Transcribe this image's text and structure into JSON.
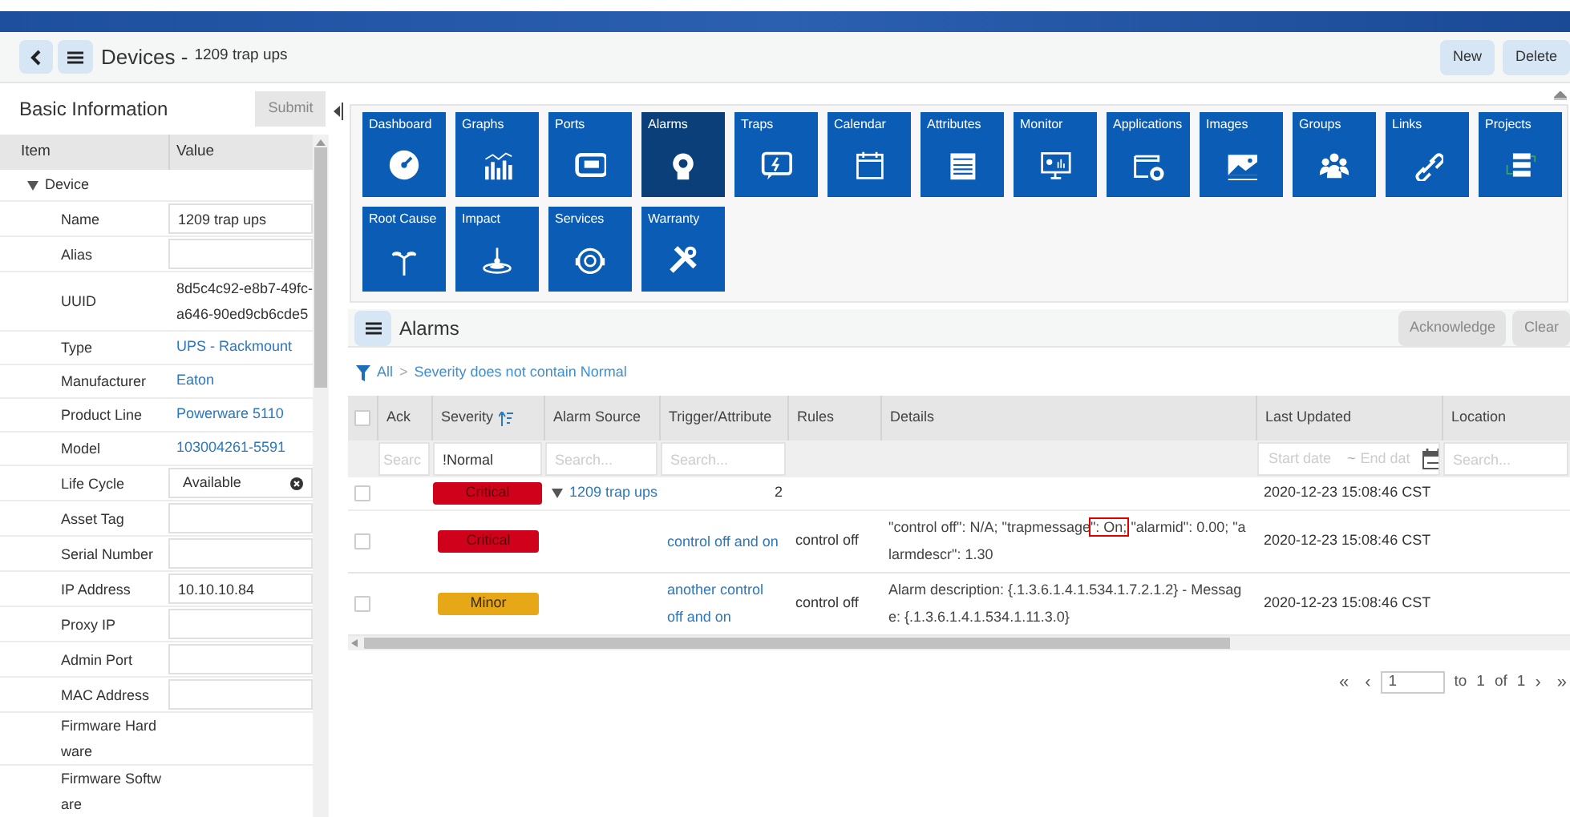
{
  "header": {
    "title": "Devices -",
    "subtitle": "1209 trap ups",
    "buttons": [
      "New",
      "Delete"
    ]
  },
  "basic_information": {
    "title": "Basic Information",
    "submit": "Submit",
    "columns": [
      "Item",
      "Value"
    ],
    "group": {
      "label": "Device",
      "expanded": true
    },
    "rows": [
      {
        "label": "Name",
        "kind": "input",
        "value": "1209 trap ups"
      },
      {
        "label": "Alias",
        "kind": "input",
        "value": ""
      },
      {
        "label": "UUID",
        "kind": "text",
        "value": "8d5c4c92-e8b7-49fc-a646-90ed9cb6cde5"
      },
      {
        "label": "Type",
        "kind": "link",
        "value": "UPS - Rackmount"
      },
      {
        "label": "Manufacturer",
        "kind": "link",
        "value": "Eaton"
      },
      {
        "label": "Product Line",
        "kind": "link",
        "value": "Powerware 5110"
      },
      {
        "label": "Model",
        "kind": "link",
        "value": "103004261-5591"
      },
      {
        "label": "Life Cycle",
        "kind": "select",
        "value": "Available"
      },
      {
        "label": "Asset Tag",
        "kind": "input",
        "value": ""
      },
      {
        "label": "Serial Number",
        "kind": "input",
        "value": ""
      },
      {
        "label": "IP Address",
        "kind": "input",
        "value": "10.10.10.84"
      },
      {
        "label": "Proxy IP",
        "kind": "input",
        "value": ""
      },
      {
        "label": "Admin Port",
        "kind": "input",
        "value": ""
      },
      {
        "label": "MAC Address",
        "kind": "input",
        "value": ""
      },
      {
        "label": "Firmware Hardware",
        "kind": "text",
        "value": ""
      },
      {
        "label": "Firmware Software",
        "kind": "text",
        "value": ""
      }
    ]
  },
  "tiles": [
    {
      "label": "Dashboard",
      "selected": false
    },
    {
      "label": "Graphs",
      "selected": false
    },
    {
      "label": "Ports",
      "selected": false
    },
    {
      "label": "Alarms",
      "selected": true
    },
    {
      "label": "Traps",
      "selected": false
    },
    {
      "label": "Calendar",
      "selected": false
    },
    {
      "label": "Attributes",
      "selected": false
    },
    {
      "label": "Monitor",
      "selected": false
    },
    {
      "label": "Applications",
      "selected": false
    },
    {
      "label": "Images",
      "selected": false
    },
    {
      "label": "Groups",
      "selected": false
    },
    {
      "label": "Links",
      "selected": false
    },
    {
      "label": "Projects",
      "selected": false
    },
    {
      "label": "Root Cause",
      "selected": false
    },
    {
      "label": "Impact",
      "selected": false
    },
    {
      "label": "Services",
      "selected": false
    },
    {
      "label": "Warranty",
      "selected": false
    }
  ],
  "alarms": {
    "title": "Alarms",
    "select_all_checked": false,
    "buttons": [
      "Acknowledge",
      "Clear"
    ],
    "filter": {
      "root": "All",
      "separator": ">",
      "condition": "Severity does not contain Normal"
    },
    "columns": [
      "Ack",
      "Severity",
      "Alarm Source",
      "Trigger/Attribute",
      "Rules",
      "Details",
      "Last Updated",
      "Location"
    ],
    "column_filters": {
      "ack": {
        "placeholder": "Searc"
      },
      "severity": {
        "value": "!Normal"
      },
      "alarm_source": {
        "placeholder": "Search..."
      },
      "trigger": {
        "placeholder": "Search..."
      },
      "start_date": {
        "placeholder": "Start date"
      },
      "date_separator": "~",
      "end_date": {
        "placeholder": "End dat"
      },
      "location": {
        "placeholder": "Search..."
      }
    },
    "group_row": {
      "checked": false,
      "severity": "Critical",
      "color": "#d0021b",
      "source": "1209 trap ups",
      "expanded": true,
      "count": "2",
      "last_updated": "2020-12-23 15:08:46 CST"
    },
    "rows": [
      {
        "checked": false,
        "severity": "Critical",
        "color": "#d0021b",
        "trigger": "control off and on",
        "rules": "control off",
        "details": [
          {
            "text": "\"control off\": N/A; \"trapmessage",
            "highlighted": false
          },
          {
            "text": "\": On;",
            "highlighted": true
          },
          {
            "text": " \"alarmid\": 0.00; \"alarmdescr\": 1.30",
            "highlighted": false
          }
        ],
        "last_updated": "2020-12-23 15:08:46 CST"
      },
      {
        "checked": false,
        "severity": "Minor",
        "color": "#e6a817",
        "trigger": "another control off and on",
        "rules": "control off",
        "details": [
          {
            "text": "Alarm description: {.1.3.6.1.4.1.534.1.7.2.1.2} - Message: {.1.3.6.1.4.1.534.1.11.3.0}",
            "highlighted": false
          }
        ],
        "last_updated": "2020-12-23 15:08:46 CST"
      }
    ]
  },
  "pagination": {
    "first": "«",
    "prev": "‹",
    "page": "1",
    "to": "to",
    "from_page": "1",
    "of": "of",
    "total": "1",
    "next": "›",
    "last": "»"
  }
}
